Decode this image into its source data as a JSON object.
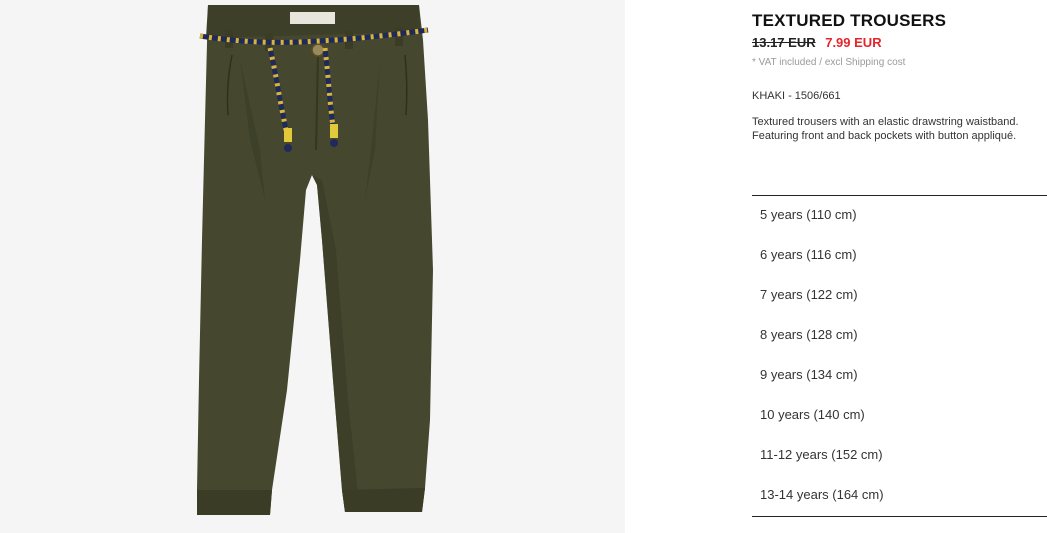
{
  "product": {
    "title": "TEXTURED TROUSERS",
    "old_price": "13.17 EUR",
    "sale_price": "7.99 EUR",
    "vat_note": "* VAT included / excl Shipping cost",
    "color_ref": "KHAKI - 1506/661",
    "description": "Textured trousers with an elastic drawstring waistband. Featuring front and back pockets with button appliqué.",
    "image_icon": "khaki-trousers-image"
  },
  "sizes": [
    "5 years (110 cm)",
    "6 years (116 cm)",
    "7 years (122 cm)",
    "8 years (128 cm)",
    "9 years (134 cm)",
    "10 years (140 cm)",
    "11-12 years (152 cm)",
    "13-14 years (164 cm)"
  ],
  "colors": {
    "sale_red": "#e3252c",
    "khaki": "#45472f",
    "image_bg": "#f5f5f5"
  }
}
